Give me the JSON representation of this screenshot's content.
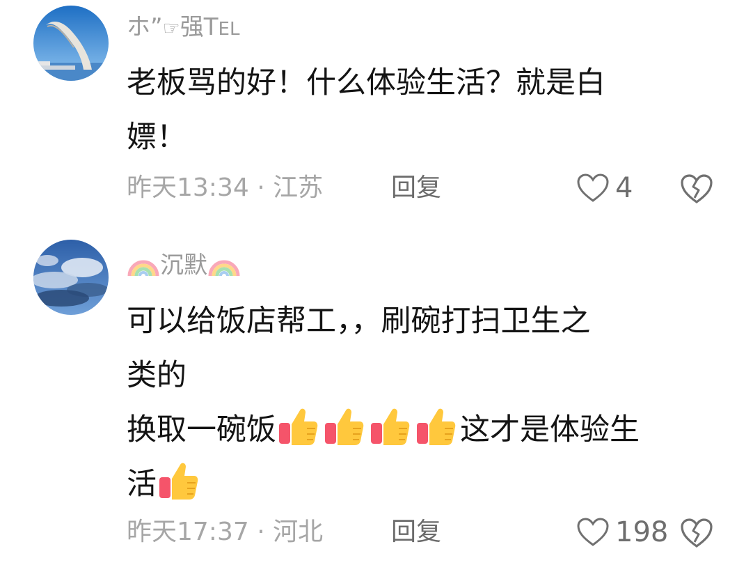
{
  "comments": [
    {
      "username_parts": [
        "ホ”",
        "☞",
        "强T",
        "EL"
      ],
      "content_lines": [
        "老板骂的好！什么体验生活？就是白",
        "嫖！"
      ],
      "time_location": "昨天13:34 · 江苏",
      "reply_label": "回复",
      "like_count": "4",
      "avatar": "lighthouse-pier-avatar"
    },
    {
      "username_prefix_icon": "rainbow-icon",
      "username": "沉默",
      "username_suffix_icon": "rainbow-icon",
      "content_lines": [
        "可以给饭店帮工，，刷碗打扫卫生之",
        "类的",
        "换取一碗饭",
        "这才是体验生",
        "活"
      ],
      "time_location": "昨天17:37 · 河北",
      "reply_label": "回复",
      "like_count": "198",
      "avatar": "cloudy-sky-avatar"
    }
  ],
  "colors": {
    "meta_text": "#a6a6a6",
    "reply_text": "#6b6b6b",
    "username": "#9a9a9a",
    "content": "#141414",
    "thumb_yellow": "#ffc83d",
    "thumb_red": "#f5546a"
  }
}
